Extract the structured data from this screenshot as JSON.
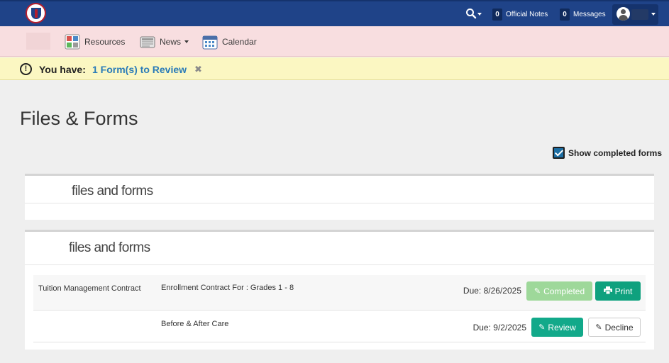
{
  "colors": {
    "topbar": "#1f4388",
    "navbar": "#f8dee0",
    "alert": "#fbf7c2",
    "link": "#2a7bb8",
    "completed_button": "#9ed89a",
    "print_button": "#0fa17e",
    "review_button": "#12a98a"
  },
  "topbar": {
    "official_notes_count": "0",
    "official_notes_label": "Official Notes",
    "messages_count": "0",
    "messages_label": "Messages"
  },
  "nav": {
    "items": [
      {
        "label": "Resources",
        "icon": "resources-icon"
      },
      {
        "label": "News",
        "icon": "news-icon"
      },
      {
        "label": "Calendar",
        "icon": "calendar-icon"
      }
    ]
  },
  "alert": {
    "prefix": "You have:",
    "link": "1 Form(s) to Review",
    "close": "✖"
  },
  "page": {
    "title": "Files & Forms",
    "show_completed_label": "Show completed forms",
    "show_completed_checked": true
  },
  "sections": [
    {
      "heading": "files and forms"
    },
    {
      "heading": "files and forms",
      "rows": [
        {
          "name": "Tuition Management Contract",
          "form": "Enrollment Contract For : Grades 1 - 8",
          "due": "Due: 8/26/2025",
          "actions": [
            "Completed",
            "Print"
          ]
        },
        {
          "name": "",
          "form": "Before & After Care",
          "due": "Due: 9/2/2025",
          "actions": [
            "Review",
            "Decline"
          ]
        }
      ]
    }
  ]
}
